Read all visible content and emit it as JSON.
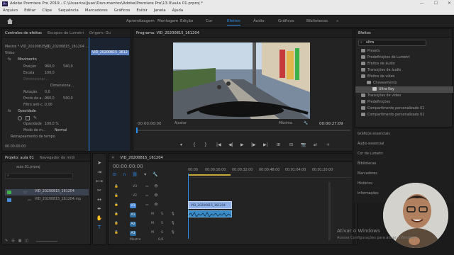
{
  "window": {
    "title": "Adobe Premiere Pro 2019 - C:\\Usuarios\\Juan\\Documentos\\Adobe\\Premiere Pro\\13.0\\aula 01.prproj *",
    "app_icon": "Pr",
    "controls": [
      "—",
      "☐",
      "✕"
    ]
  },
  "menu": [
    "Arquivo",
    "Editar",
    "Clipe",
    "Sequência",
    "Marcadores",
    "Gráficos",
    "Exibir",
    "Janela",
    "Ajuda"
  ],
  "workspaces": {
    "home_icon": "home-icon",
    "tabs": [
      "Aprendizagem",
      "Montagem",
      "Edição",
      "Cor",
      "Efeitos",
      "Áudio",
      "Gráficos",
      "Bibliotecas"
    ],
    "active": "Efeitos",
    "more": "»"
  },
  "effect_controls": {
    "tabs": [
      "Controles de efeitos",
      "Escopos de Lumetri",
      "Origem: Ou"
    ],
    "master": "Mestre * VID_20200815_1...",
    "clip": "VID_20200815_161204 ...",
    "clip_badge": "VID_20200815_1612",
    "section": "Vídeo",
    "movement": "Movimento",
    "position_label": "Posição",
    "position_x": "960,0",
    "position_y": "540,0",
    "scale_label": "Escala",
    "scale_value": "100,0",
    "scale_width_label": "Dimensionar...",
    "uniform_label": "Dimensiona...",
    "rotation_label": "Rotação",
    "rotation_value": "0,0",
    "anchor_label": "Ponto de a...",
    "anchor_x": "960,0",
    "anchor_y": "540,0",
    "flicker_label": "Filtro anti-c...",
    "flicker_value": "0,00",
    "opacity_section": "Opacidade",
    "opacity_label": "Opacidade",
    "opacity_value": "100,0 %",
    "blend_label": "Modo de m...",
    "blend_value": "Normal",
    "remap_label": "Remapeamento de tempo",
    "timecode": "00:00:00:00"
  },
  "program_monitor": {
    "tab": "Programa: VID_20200815_161204",
    "timecode_in": "00:00:00:00",
    "fit_label": "Ajustar",
    "quality_label": "Máxima",
    "timecode_out": "00:00:27:09",
    "buttons": [
      "▾",
      "{",
      "}",
      "|◀",
      "◀|",
      "▶",
      "|▶",
      "▶|",
      "⊞",
      "⊟",
      "📷",
      "⇄",
      "+"
    ]
  },
  "project": {
    "tabs": [
      "Projeto: aula 01",
      "Navegador de mídi"
    ],
    "filename": "aula 01.prproj",
    "search_placeholder": "",
    "items_count": "",
    "items": [
      {
        "name": "VID_20200815_161204",
        "color": "#3fb04a"
      },
      {
        "name": "VID_20200815_161204.mp",
        "color": "#4a8ad9"
      }
    ]
  },
  "timeline": {
    "tab": "VID_20200815_161204",
    "timecode": "00:00:00:00",
    "ruler": [
      "00:00",
      "00:00:16:00",
      "00:00:32:00",
      "00:00:48:00",
      "00:01:04:00",
      "00:01:20:00"
    ],
    "video_tracks": [
      "V3",
      "V2",
      "V1"
    ],
    "audio_tracks": [
      "A1",
      "A2",
      "A3"
    ],
    "master_label": "Mestre",
    "master_value": "0,0",
    "video_clip": "VID_20200815_161204",
    "audio_clip": "",
    "track_letters": {
      "mute": "M",
      "solo": "S"
    }
  },
  "effects_panel": {
    "tab": "Efeitos",
    "search_value": "ultra",
    "items": [
      {
        "label": "Presets",
        "level": 0
      },
      {
        "label": "Predefinições de Lumetri",
        "level": 0
      },
      {
        "label": "Efeitos de áudio",
        "level": 0
      },
      {
        "label": "Transições de áudio",
        "level": 0
      },
      {
        "label": "Efeitos de vídeo",
        "level": 0
      },
      {
        "label": "Chaveamento",
        "level": 1
      },
      {
        "label": "Ultra Key",
        "level": 2
      },
      {
        "label": "Transições de vídeo",
        "level": 0
      },
      {
        "label": "Predefinições",
        "level": 0
      },
      {
        "label": "Compartimento personalizado 01",
        "level": 0
      },
      {
        "label": "Compartimento personalizado 02",
        "level": 0
      }
    ],
    "side_panels": [
      "Gráficos essenciais",
      "Áudio essencial",
      "Cor de Lumetri",
      "Bibliotecas",
      "Marcadores",
      "Histórico",
      "Informações"
    ]
  },
  "watermark": {
    "line1": "Ativar o Windows",
    "line2": "Acesse Configurações para ativar o Windows."
  },
  "colors": {
    "accent": "#2d8ceb",
    "clip_video": "#8fb0e6",
    "clip_audio": "#3a8cc9",
    "label_green": "#3fb04a"
  }
}
